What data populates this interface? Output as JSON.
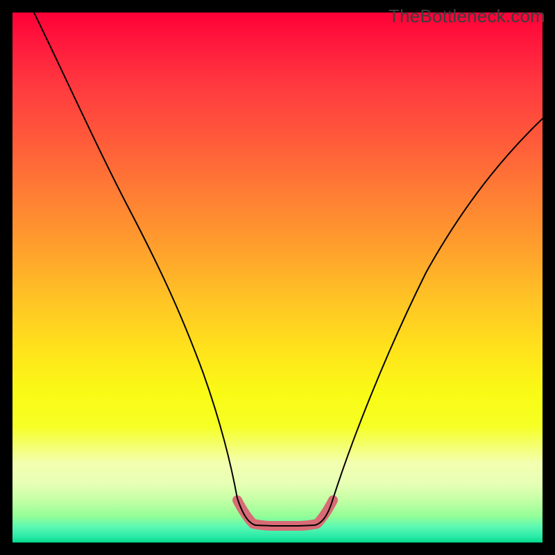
{
  "watermark": "TheBottleneck.com",
  "chart_data": {
    "type": "line",
    "title": "",
    "xlabel": "",
    "ylabel": "",
    "xlim": [
      0,
      100
    ],
    "ylim": [
      0,
      100
    ],
    "series": [
      {
        "name": "black-curve",
        "x": [
          4,
          10,
          16,
          22,
          28,
          34,
          38,
          41,
          43,
          44.5,
          46,
          49,
          54,
          56,
          57.5,
          60,
          64,
          70,
          78,
          88,
          98
        ],
        "y": [
          100,
          88,
          76,
          63,
          50,
          36,
          25,
          16,
          10,
          5.5,
          3.5,
          3.3,
          3.3,
          3.5,
          5.5,
          11,
          21,
          35,
          51,
          67,
          80
        ],
        "stroke": "#000000",
        "stroke_width": 2
      },
      {
        "name": "pink-highlight",
        "x": [
          42.5,
          44,
          45.5,
          49,
          54,
          56,
          57.5,
          59
        ],
        "y": [
          8,
          5,
          3.5,
          3.3,
          3.3,
          3.5,
          5,
          8
        ],
        "stroke": "#d86b75",
        "stroke_width": 14
      }
    ],
    "background_gradient": {
      "top": "#ff0037",
      "middle": "#ffe41b",
      "bottom": "#03d989"
    }
  }
}
